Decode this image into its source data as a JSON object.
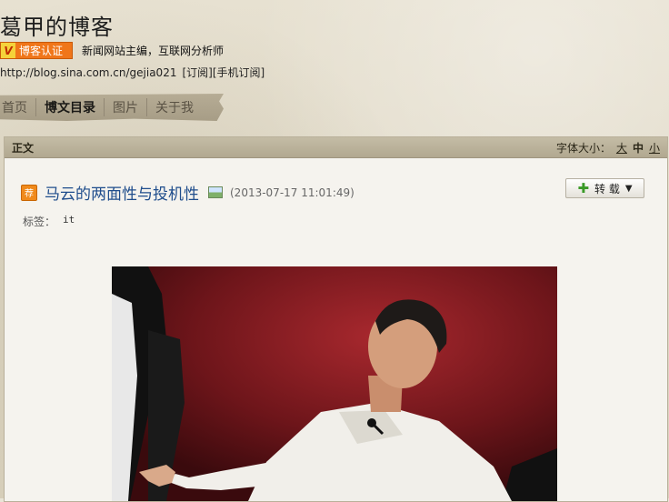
{
  "blog": {
    "title": "葛甲的博客",
    "badge": "博客认证",
    "author_desc": "新闻网站主编，互联网分析师",
    "url": "http://blog.sina.com.cn/gejia021",
    "subscribe": "[订阅]",
    "mobile_subscribe": "[手机订阅]"
  },
  "nav": {
    "items": [
      {
        "label": "首页"
      },
      {
        "label": "博文目录"
      },
      {
        "label": "图片"
      },
      {
        "label": "关于我"
      }
    ],
    "active": "博文目录"
  },
  "panel": {
    "section_title": "正文",
    "font_size_label": "字体大小：",
    "font_sizes": [
      "大",
      "中",
      "小"
    ],
    "current_font_size": "中"
  },
  "post": {
    "rec_icon_text": "荐",
    "title": "马云的两面性与投机性",
    "date": "(2013-07-17 11:01:49)",
    "repost_label": "转 载",
    "tags_label": "标签：",
    "tags": [
      "it"
    ]
  },
  "colors": {
    "badge": "#f0761a",
    "post_title": "#1f4d8c",
    "photo_bg": "#6a1418"
  },
  "icons": {
    "badge": "v-verified-icon",
    "recommend": "recommend-icon",
    "image": "image-icon",
    "repost_plus": "plus-icon",
    "repost_dropdown": "triangle-down-icon"
  }
}
